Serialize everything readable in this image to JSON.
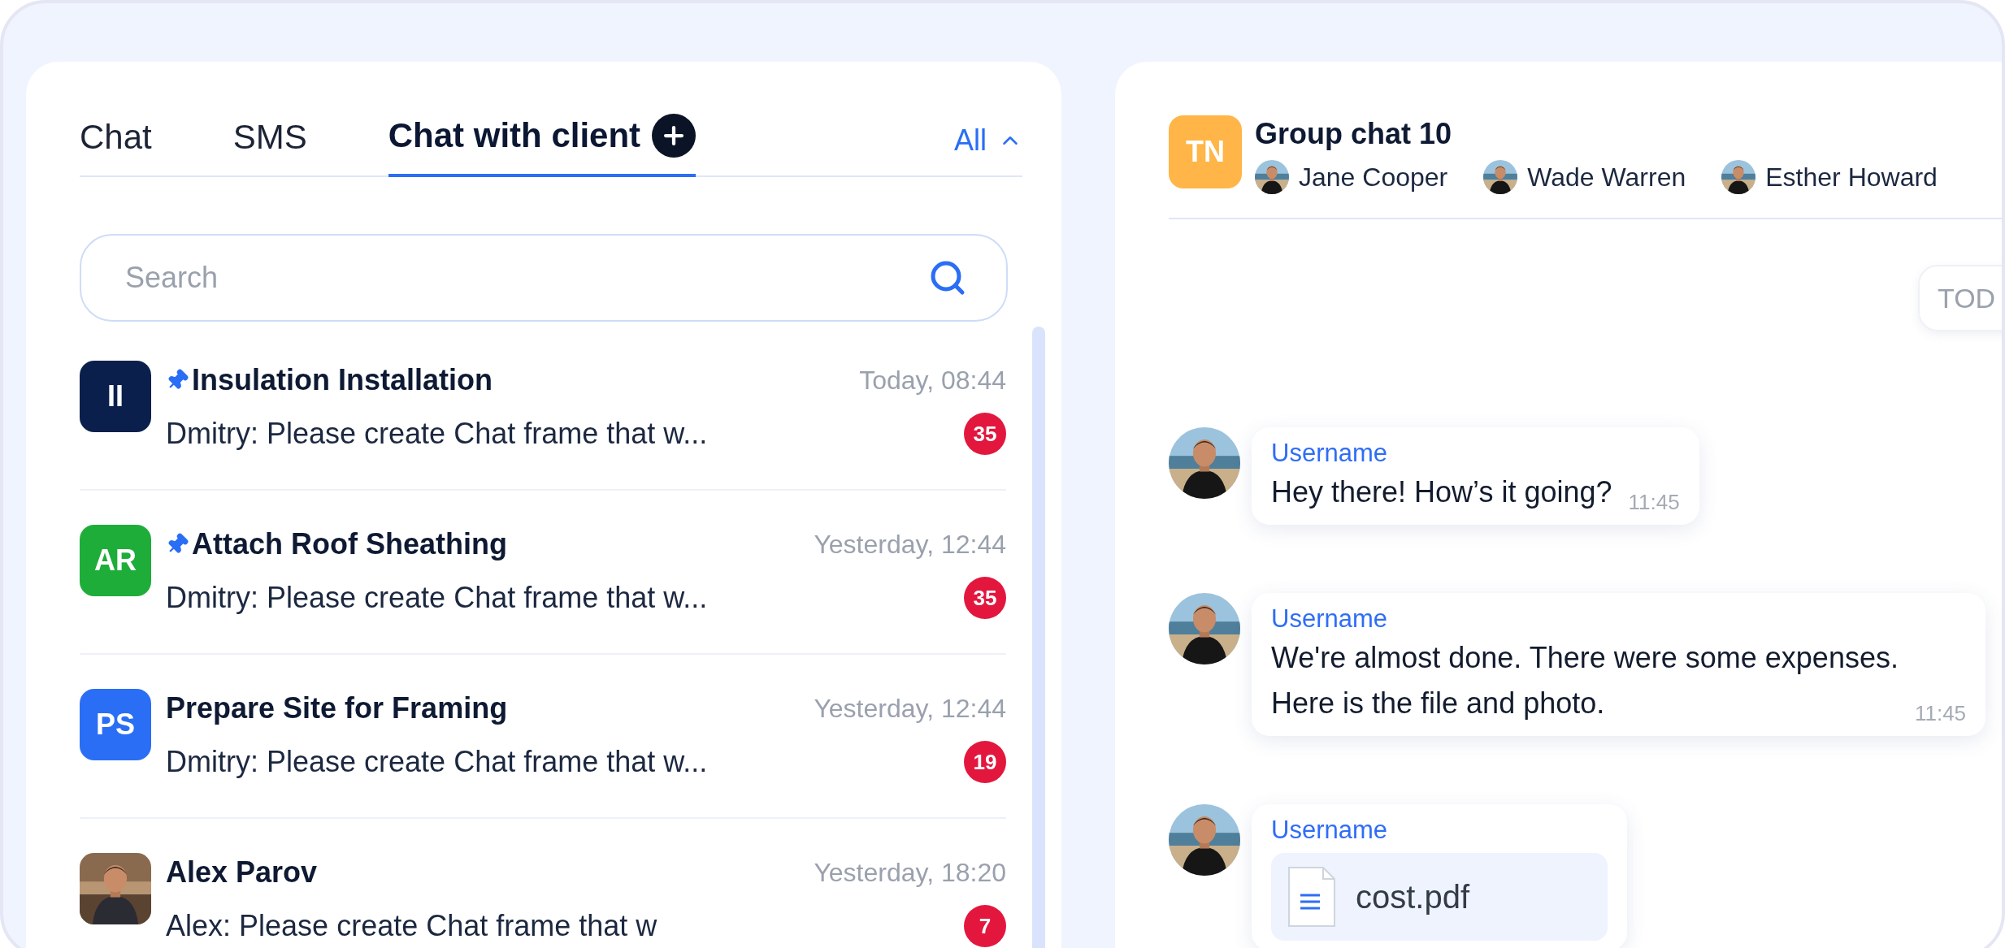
{
  "tabs": [
    {
      "label": "Chat",
      "selected": false
    },
    {
      "label": "SMS",
      "selected": false
    },
    {
      "label": "Chat with client",
      "selected": true
    }
  ],
  "filter": {
    "label": "All",
    "expanded": true
  },
  "search": {
    "placeholder": "Search"
  },
  "chats": [
    {
      "kind": "initials",
      "initials": "II",
      "color": "#0b1f4d",
      "pinned": true,
      "title": "Insulation Installation",
      "time": "Today, 08:44",
      "sender": "Dmitry:",
      "preview": "Please create Chat frame that w...",
      "unread": "35"
    },
    {
      "kind": "initials",
      "initials": "AR",
      "color": "#1fad3a",
      "pinned": true,
      "title": "Attach Roof Sheathing",
      "time": "Yesterday, 12:44",
      "sender": "Dmitry:",
      "preview": "Please create Chat frame that w...",
      "unread": "35"
    },
    {
      "kind": "initials",
      "initials": "PS",
      "color": "#2a6ef5",
      "pinned": false,
      "title": "Prepare Site for Framing",
      "time": "Yesterday, 12:44",
      "sender": "Dmitry:",
      "preview": "Please create Chat frame that w...",
      "unread": "19"
    },
    {
      "kind": "picture",
      "pinned": false,
      "title": "Alex Parov",
      "time": "Yesterday, 18:20",
      "sender": "Alex:",
      "preview": "Please create Chat frame that w",
      "unread": "7"
    }
  ],
  "conversation": {
    "initials": "TN",
    "title": "Group chat 10",
    "members": [
      "Jane Cooper",
      "Wade Warren",
      "Esther Howard"
    ],
    "date_label": "TOD",
    "messages": [
      {
        "kind": "text",
        "author": "Username",
        "text": "Hey there! How’s it going?",
        "time": "11:45"
      },
      {
        "kind": "text",
        "author": "Username",
        "text": "We're almost done. There were some expenses.\nHere is the file and photo.",
        "time": "11:45"
      },
      {
        "kind": "file",
        "author": "Username",
        "file": "cost.pdf"
      }
    ]
  }
}
